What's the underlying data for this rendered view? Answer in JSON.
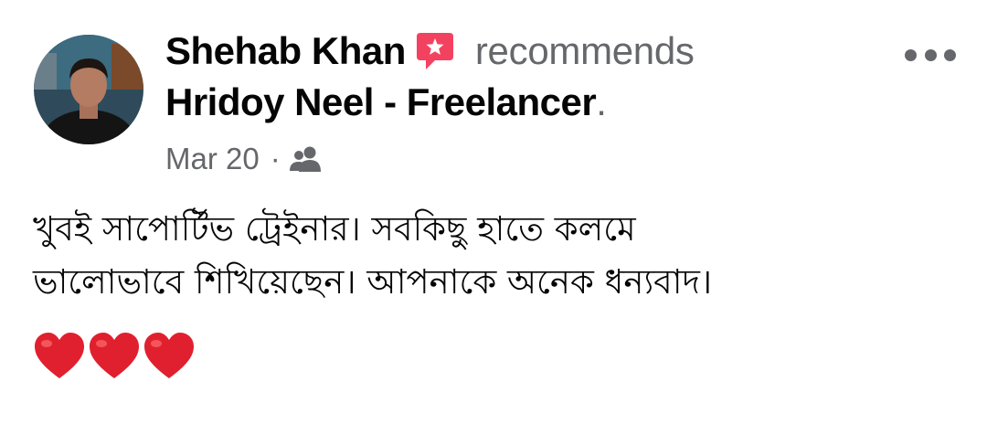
{
  "post": {
    "author": "Shehab Khan",
    "recommend_text": "recommends",
    "page_name": "Hridoy Neel - Freelancer",
    "page_name_suffix": ".",
    "date": "Mar 20",
    "separator": "·",
    "audience_icon": "friends-icon",
    "more_icon": "more-options-icon",
    "recommend_icon": "recommend-star-icon",
    "body_line_1": "খুবই সাপোর্টিভ ট্রেইনার। সবকিছু হাতে কলমে",
    "body_line_2": "ভালোভাবে শিখিয়েছেন। আপনাকে অনেক ধন্যবাদ।",
    "reactions": [
      "heart",
      "heart",
      "heart"
    ],
    "colors": {
      "recommend_icon": "#f3425f",
      "heart": "#e0202f",
      "secondary_text": "#65676b",
      "primary_text": "#050505"
    }
  }
}
